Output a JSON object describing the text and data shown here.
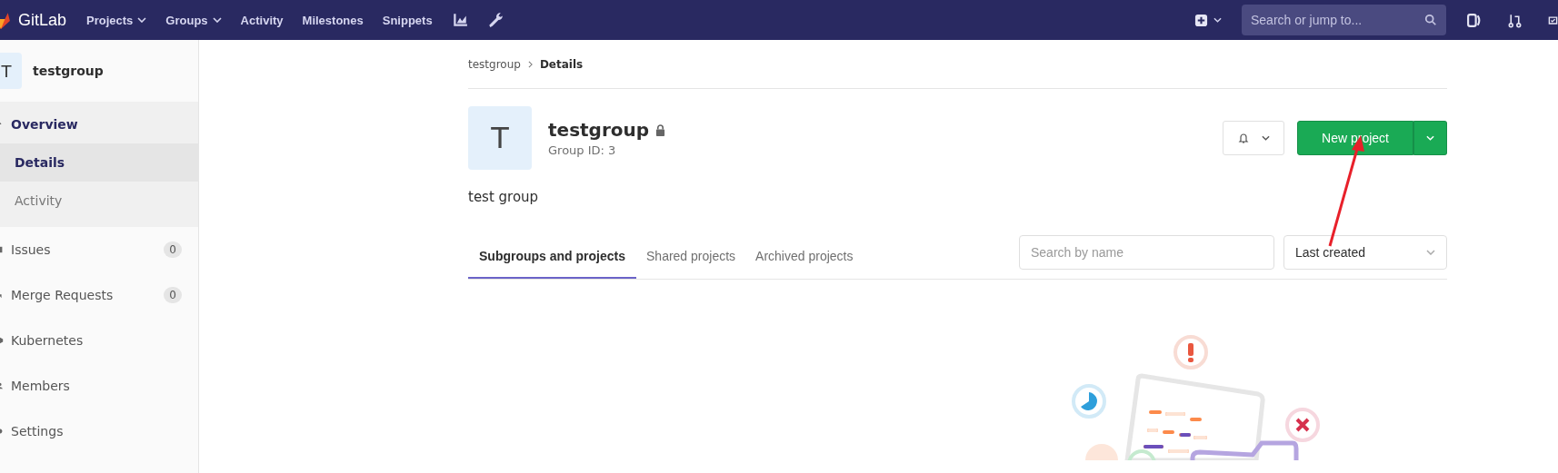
{
  "navbar": {
    "logo_text": "GitLab",
    "menu": [
      {
        "label": "Projects",
        "dropdown": true
      },
      {
        "label": "Groups",
        "dropdown": true
      },
      {
        "label": "Activity",
        "dropdown": false
      },
      {
        "label": "Milestones",
        "dropdown": false
      },
      {
        "label": "Snippets",
        "dropdown": false
      }
    ],
    "search": {
      "placeholder": "Search or jump to..."
    }
  },
  "sidebar": {
    "avatar_letter": "T",
    "group_name": "testgroup",
    "items": [
      {
        "kind": "overview",
        "label": "Overview",
        "selected": true,
        "expanded": true,
        "children": [
          {
            "label": "Details",
            "selected": true
          },
          {
            "label": "Activity",
            "selected": false
          }
        ]
      },
      {
        "kind": "issues",
        "label": "Issues",
        "count": "0",
        "selected": false
      },
      {
        "kind": "merge",
        "label": "Merge Requests",
        "count": "0",
        "selected": false
      },
      {
        "kind": "kubernetes",
        "label": "Kubernetes",
        "selected": false
      },
      {
        "kind": "members",
        "label": "Members",
        "selected": false
      },
      {
        "kind": "settings",
        "label": "Settings",
        "selected": false
      }
    ]
  },
  "breadcrumb": [
    "testgroup",
    "Details"
  ],
  "group": {
    "avatar_letter": "T",
    "name": "testgroup",
    "private": true,
    "id_text": "Group ID: 3",
    "description": "test group"
  },
  "actions": {
    "new_project": "New project"
  },
  "tabs": [
    {
      "label": "Subgroups and projects",
      "selected": true
    },
    {
      "label": "Shared projects",
      "selected": false
    },
    {
      "label": "Archived projects",
      "selected": false
    }
  ],
  "filter": {
    "search_placeholder": "Search by name",
    "sort_value": "Last created"
  }
}
